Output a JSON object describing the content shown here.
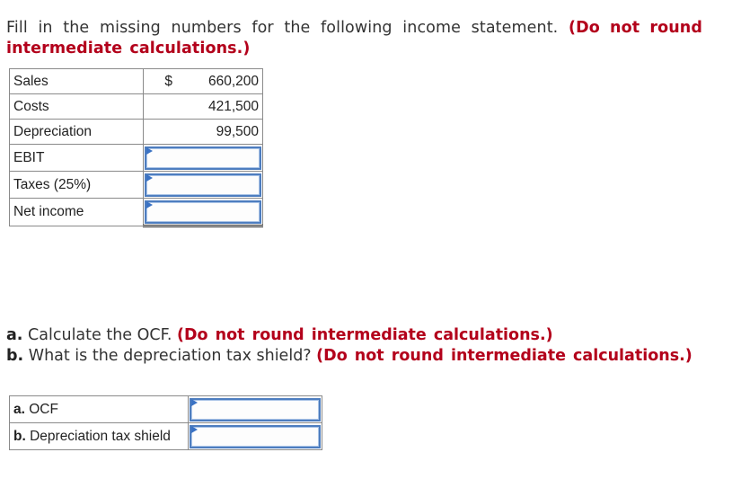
{
  "prompt": {
    "text": "Fill in the missing numbers for the following income statement.",
    "instruction": "(Do not round intermediate calculations.)"
  },
  "income_statement": {
    "currency_symbol": "$",
    "rows": [
      {
        "label": "Sales",
        "value": "660,200",
        "editable": false
      },
      {
        "label": "Costs",
        "value": "421,500",
        "editable": false
      },
      {
        "label": "Depreciation",
        "value": "99,500",
        "editable": false
      },
      {
        "label": "EBIT",
        "value": "",
        "editable": true
      },
      {
        "label": "Taxes (25%)",
        "value": "",
        "editable": true
      },
      {
        "label": "Net income",
        "value": "",
        "editable": true
      }
    ]
  },
  "questions": [
    {
      "letter": "a.",
      "text": "Calculate the OCF.",
      "instruction": "(Do not round intermediate calculations.)"
    },
    {
      "letter": "b.",
      "text": "What is the depreciation tax shield?",
      "instruction": "(Do not round intermediate calculations.)"
    }
  ],
  "answers": [
    {
      "letter": "a.",
      "label": "OCF",
      "value": ""
    },
    {
      "letter": "b.",
      "label": "Depreciation tax shield",
      "value": ""
    }
  ],
  "colors": {
    "instruction_red": "#b3001b",
    "input_border_blue": "#4d7dbf",
    "flag_blue": "#3a72c4"
  }
}
